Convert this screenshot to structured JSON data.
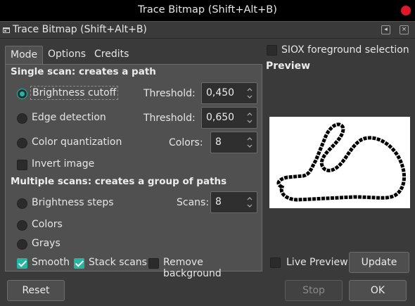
{
  "window": {
    "title": "Trace Bitmap (Shift+Alt+B)"
  },
  "dock": {
    "title": "Trace Bitmap (Shift+Alt+B)",
    "tab_icon": "dialog-tab-icon",
    "buttons": {
      "restore_glyph": "◂",
      "close_glyph": "×"
    }
  },
  "tabs": [
    {
      "label": "Mode",
      "active": true
    },
    {
      "label": "Options",
      "active": false
    },
    {
      "label": "Credits",
      "active": false
    }
  ],
  "single_scan": {
    "heading": "Single scan: creates a path",
    "options": [
      {
        "label": "Brightness cutoff",
        "selected": true,
        "field_label": "Threshold:",
        "field_value": "0,450"
      },
      {
        "label": "Edge detection",
        "selected": false,
        "field_label": "Threshold:",
        "field_value": "0,650"
      },
      {
        "label": "Color quantization",
        "selected": false,
        "field_label": "Colors:",
        "field_value": "8"
      }
    ],
    "invert_label": "Invert image",
    "invert_checked": false
  },
  "multiple_scans": {
    "heading": "Multiple scans: creates a group of paths",
    "options": [
      {
        "label": "Brightness steps",
        "selected": false
      },
      {
        "label": "Colors",
        "selected": false
      },
      {
        "label": "Grays",
        "selected": false
      }
    ],
    "scans_label": "Scans:",
    "scans_value": "8",
    "checks": [
      {
        "label": "Smooth",
        "checked": true
      },
      {
        "label": "Stack scans",
        "checked": true
      },
      {
        "label": "Remove background",
        "checked": false
      }
    ]
  },
  "siox": {
    "label": "SIOX foreground selection",
    "checked": false
  },
  "preview": {
    "heading": "Preview"
  },
  "live_preview": {
    "label": "Live Preview",
    "checked": false
  },
  "buttons": {
    "update": "Update",
    "reset": "Reset",
    "stop": "Stop",
    "ok": "OK"
  },
  "colors": {
    "accent": "#27b4a0",
    "close": "#e0182a",
    "panel": "#505050",
    "background": "#3a3a3a"
  }
}
